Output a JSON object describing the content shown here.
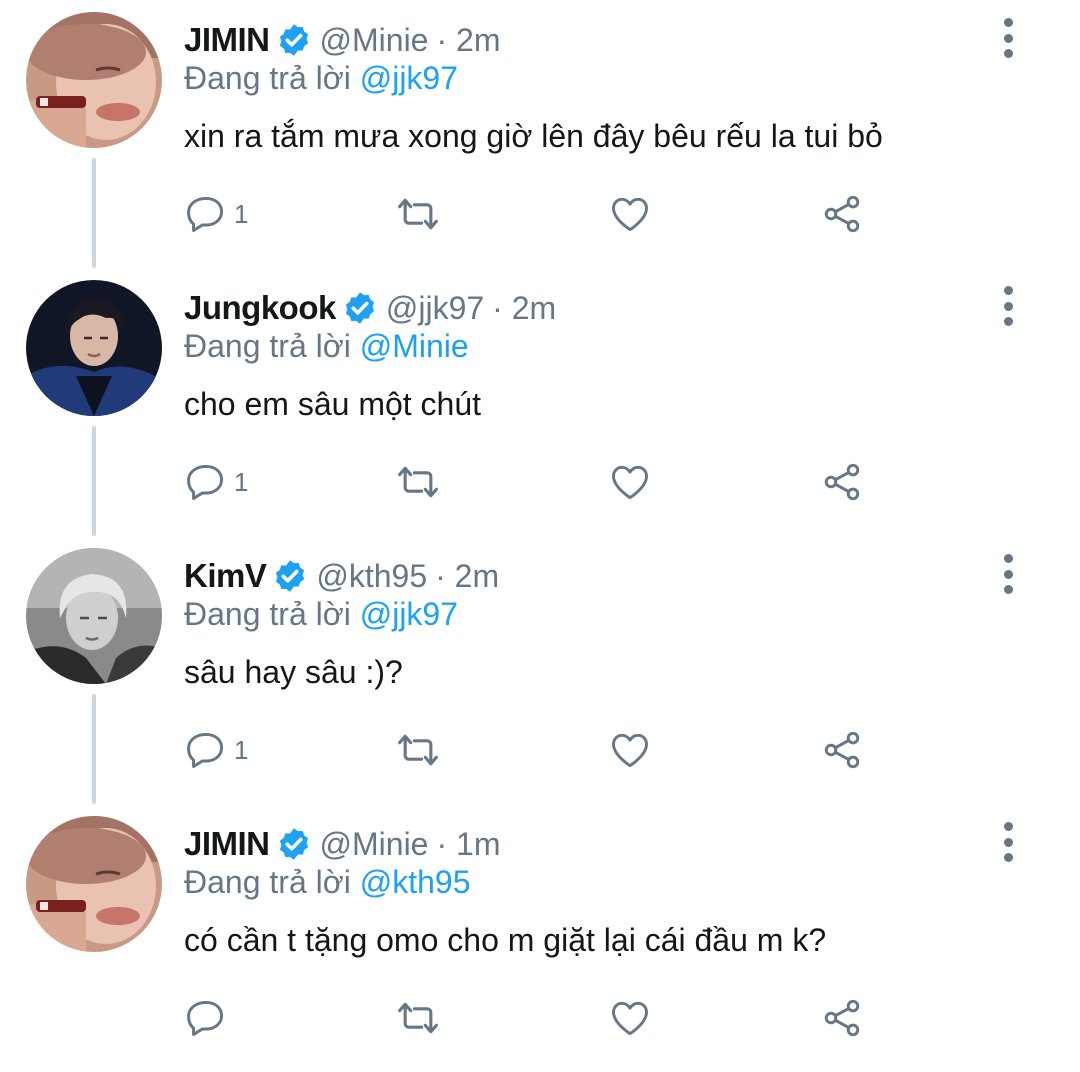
{
  "accent_color": "#1da1f2",
  "muted_color": "#657786",
  "thread_line_color": "#ccd6dd",
  "tweets": [
    {
      "name": "JIMIN",
      "handle": "@Minie",
      "time": "· 2m",
      "reply_prefix": "Đang trả lời",
      "reply_to": "@jjk97",
      "text": "xin ra tắm mưa xong giờ lên đây bêu rếu la tui bỏ",
      "reply_count": "1",
      "verified_icon": "verified-badge-icon"
    },
    {
      "name": "Jungkook",
      "handle": "@jjk97",
      "time": "· 2m",
      "reply_prefix": "Đang trả lời",
      "reply_to": "@Minie",
      "text": "cho em sâu một chút",
      "reply_count": "1",
      "verified_icon": "verified-badge-icon"
    },
    {
      "name": "KimV",
      "handle": "@kth95",
      "time": "· 2m",
      "reply_prefix": "Đang trả lời",
      "reply_to": "@jjk97",
      "text": "sâu hay sâu :)?",
      "reply_count": "1",
      "verified_icon": "verified-badge-icon"
    },
    {
      "name": "JIMIN",
      "handle": "@Minie",
      "time": "· 1m",
      "reply_prefix": "Đang trả lời",
      "reply_to": "@kth95",
      "text": "có cần t tặng omo cho m giặt lại cái đầu m k?",
      "reply_count": "",
      "verified_icon": "verified-badge-icon"
    }
  ]
}
